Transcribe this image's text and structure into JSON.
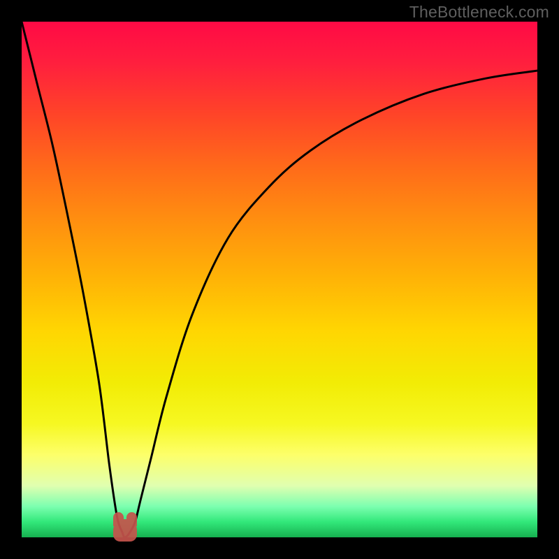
{
  "attribution": "TheBottleneck.com",
  "colors": {
    "frame_border": "#000000",
    "curve_stroke": "#000000",
    "valley_marker": "#c5544c",
    "gradient_top": "#ff0a45",
    "gradient_bottom": "#16b050"
  },
  "chart_data": {
    "type": "line",
    "title": "",
    "xlabel": "",
    "ylabel": "",
    "xlim": [
      0,
      100
    ],
    "ylim": [
      0,
      100
    ],
    "grid": false,
    "legend": null,
    "annotations": [
      {
        "text": "valley marker (optimal point)",
        "x": 20,
        "y": 2
      }
    ],
    "series": [
      {
        "name": "bottleneck-curve",
        "x": [
          0,
          3,
          6,
          9,
          12,
          15,
          17,
          18.5,
          19.5,
          20,
          21,
          22,
          23,
          25,
          28,
          33,
          40,
          48,
          56,
          66,
          78,
          90,
          100
        ],
        "y": [
          100,
          88,
          76,
          62,
          47,
          30,
          14,
          4,
          1,
          0,
          1,
          3,
          7,
          15,
          27,
          43,
          58,
          68,
          75,
          81,
          86,
          89,
          90.5
        ]
      }
    ]
  }
}
